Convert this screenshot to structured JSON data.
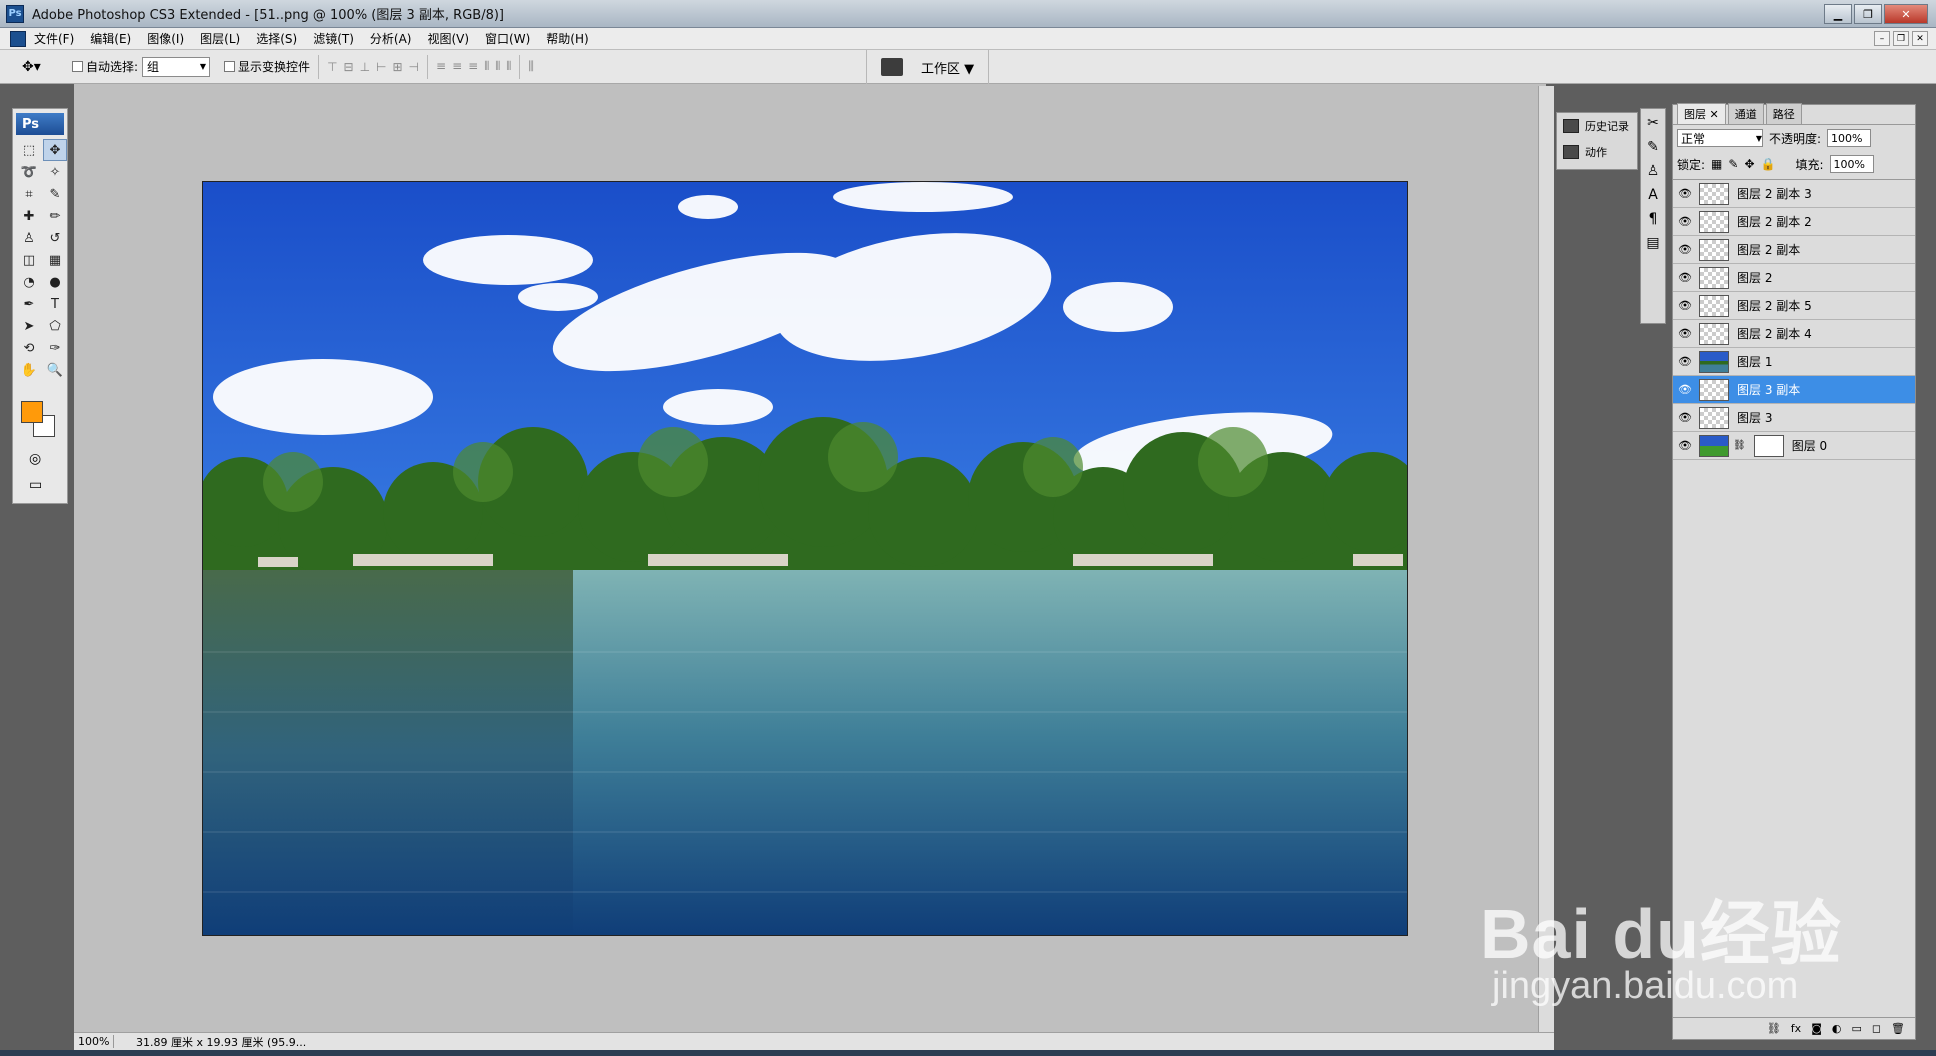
{
  "window": {
    "title": "Adobe Photoshop CS3 Extended - [51..png @ 100% (图层 3 副本, RGB/8)]",
    "logo": "Ps"
  },
  "menu": [
    "文件(F)",
    "编辑(E)",
    "图像(I)",
    "图层(L)",
    "选择(S)",
    "滤镜(T)",
    "分析(A)",
    "视图(V)",
    "窗口(W)",
    "帮助(H)"
  ],
  "options": {
    "auto_select_label": "自动选择:",
    "auto_select_value": "组",
    "show_transform_label": "显示变换控件",
    "workspace_label": "工作区 ▼"
  },
  "toolbox": {
    "header": "Ps"
  },
  "status": {
    "zoom": "100%",
    "doc_info": "31.89 厘米 x 19.93 厘米 (95.9..."
  },
  "side_panel": {
    "history": "历史记录",
    "actions": "动作"
  },
  "layers_panel": {
    "tabs": [
      "图层",
      "通道",
      "路径"
    ],
    "blend_mode": "正常",
    "opacity_label": "不透明度:",
    "opacity_value": "100%",
    "lock_label": "锁定:",
    "fill_label": "填充:",
    "fill_value": "100%",
    "layers": [
      {
        "name": "图层 2 副本 3"
      },
      {
        "name": "图层 2 副本 2"
      },
      {
        "name": "图层 2 副本"
      },
      {
        "name": "图层 2"
      },
      {
        "name": "图层 2 副本 5"
      },
      {
        "name": "图层 2 副本 4"
      },
      {
        "name": "图层 1"
      },
      {
        "name": "图层 3 副本",
        "selected": true
      },
      {
        "name": "图层 3"
      },
      {
        "name": "图层 0",
        "has_mask": true
      }
    ]
  },
  "watermark": {
    "main": "Bai du经验",
    "sub": "jingyan.baidu.com"
  },
  "colors": {
    "foreground": "#ff9a0a",
    "background": "#ffffff",
    "selection": "#3d8ee6"
  }
}
